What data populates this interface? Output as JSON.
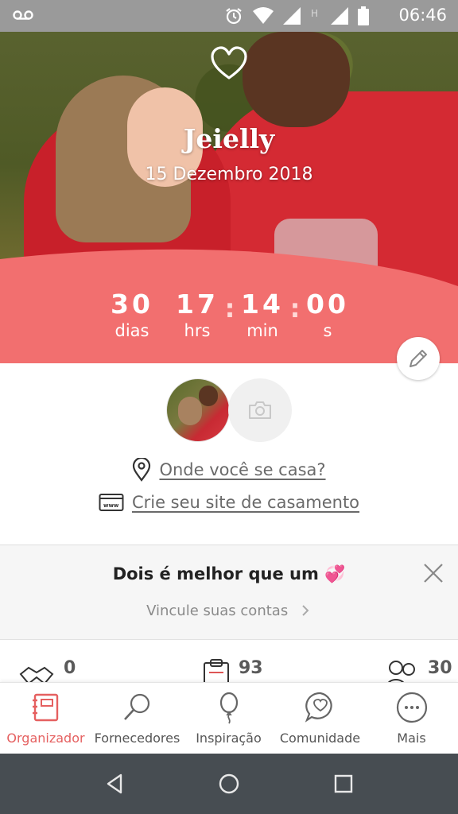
{
  "status_bar": {
    "time": "06:46",
    "icons": [
      "voicemail-icon",
      "alarm-icon",
      "wifi-icon",
      "signal-icon",
      "h-network-icon",
      "signal-icon",
      "battery-icon"
    ]
  },
  "hero": {
    "couple_name": "Jeielly",
    "wedding_date": "15 Dezembro 2018",
    "countdown": {
      "days_value": "30",
      "days_label": "dias",
      "hours_value": "17",
      "hours_label": "hrs",
      "minutes_value": "14",
      "minutes_label": "min",
      "seconds_value": "00",
      "seconds_label": "s"
    },
    "accent_color": "#f26f6f"
  },
  "profile": {
    "where_label": "Onde você se casa?",
    "site_label": "Crie seu site de casamento"
  },
  "promo": {
    "title": "Dois é melhor que um 💞",
    "link": "Vincule suas contas"
  },
  "stats": [
    {
      "icon": "handshake-icon",
      "value": "0"
    },
    {
      "icon": "clipboard-icon",
      "value": "93"
    },
    {
      "icon": "guests-icon",
      "value": "30"
    }
  ],
  "bottom_nav": {
    "items": [
      {
        "label": "Organizador",
        "icon": "planner-icon",
        "active": true
      },
      {
        "label": "Fornecedores",
        "icon": "search-icon",
        "active": false
      },
      {
        "label": "Inspiração",
        "icon": "balloon-icon",
        "active": false
      },
      {
        "label": "Comunidade",
        "icon": "chat-heart-icon",
        "active": false
      },
      {
        "label": "Mais",
        "icon": "more-icon",
        "active": false
      }
    ]
  }
}
